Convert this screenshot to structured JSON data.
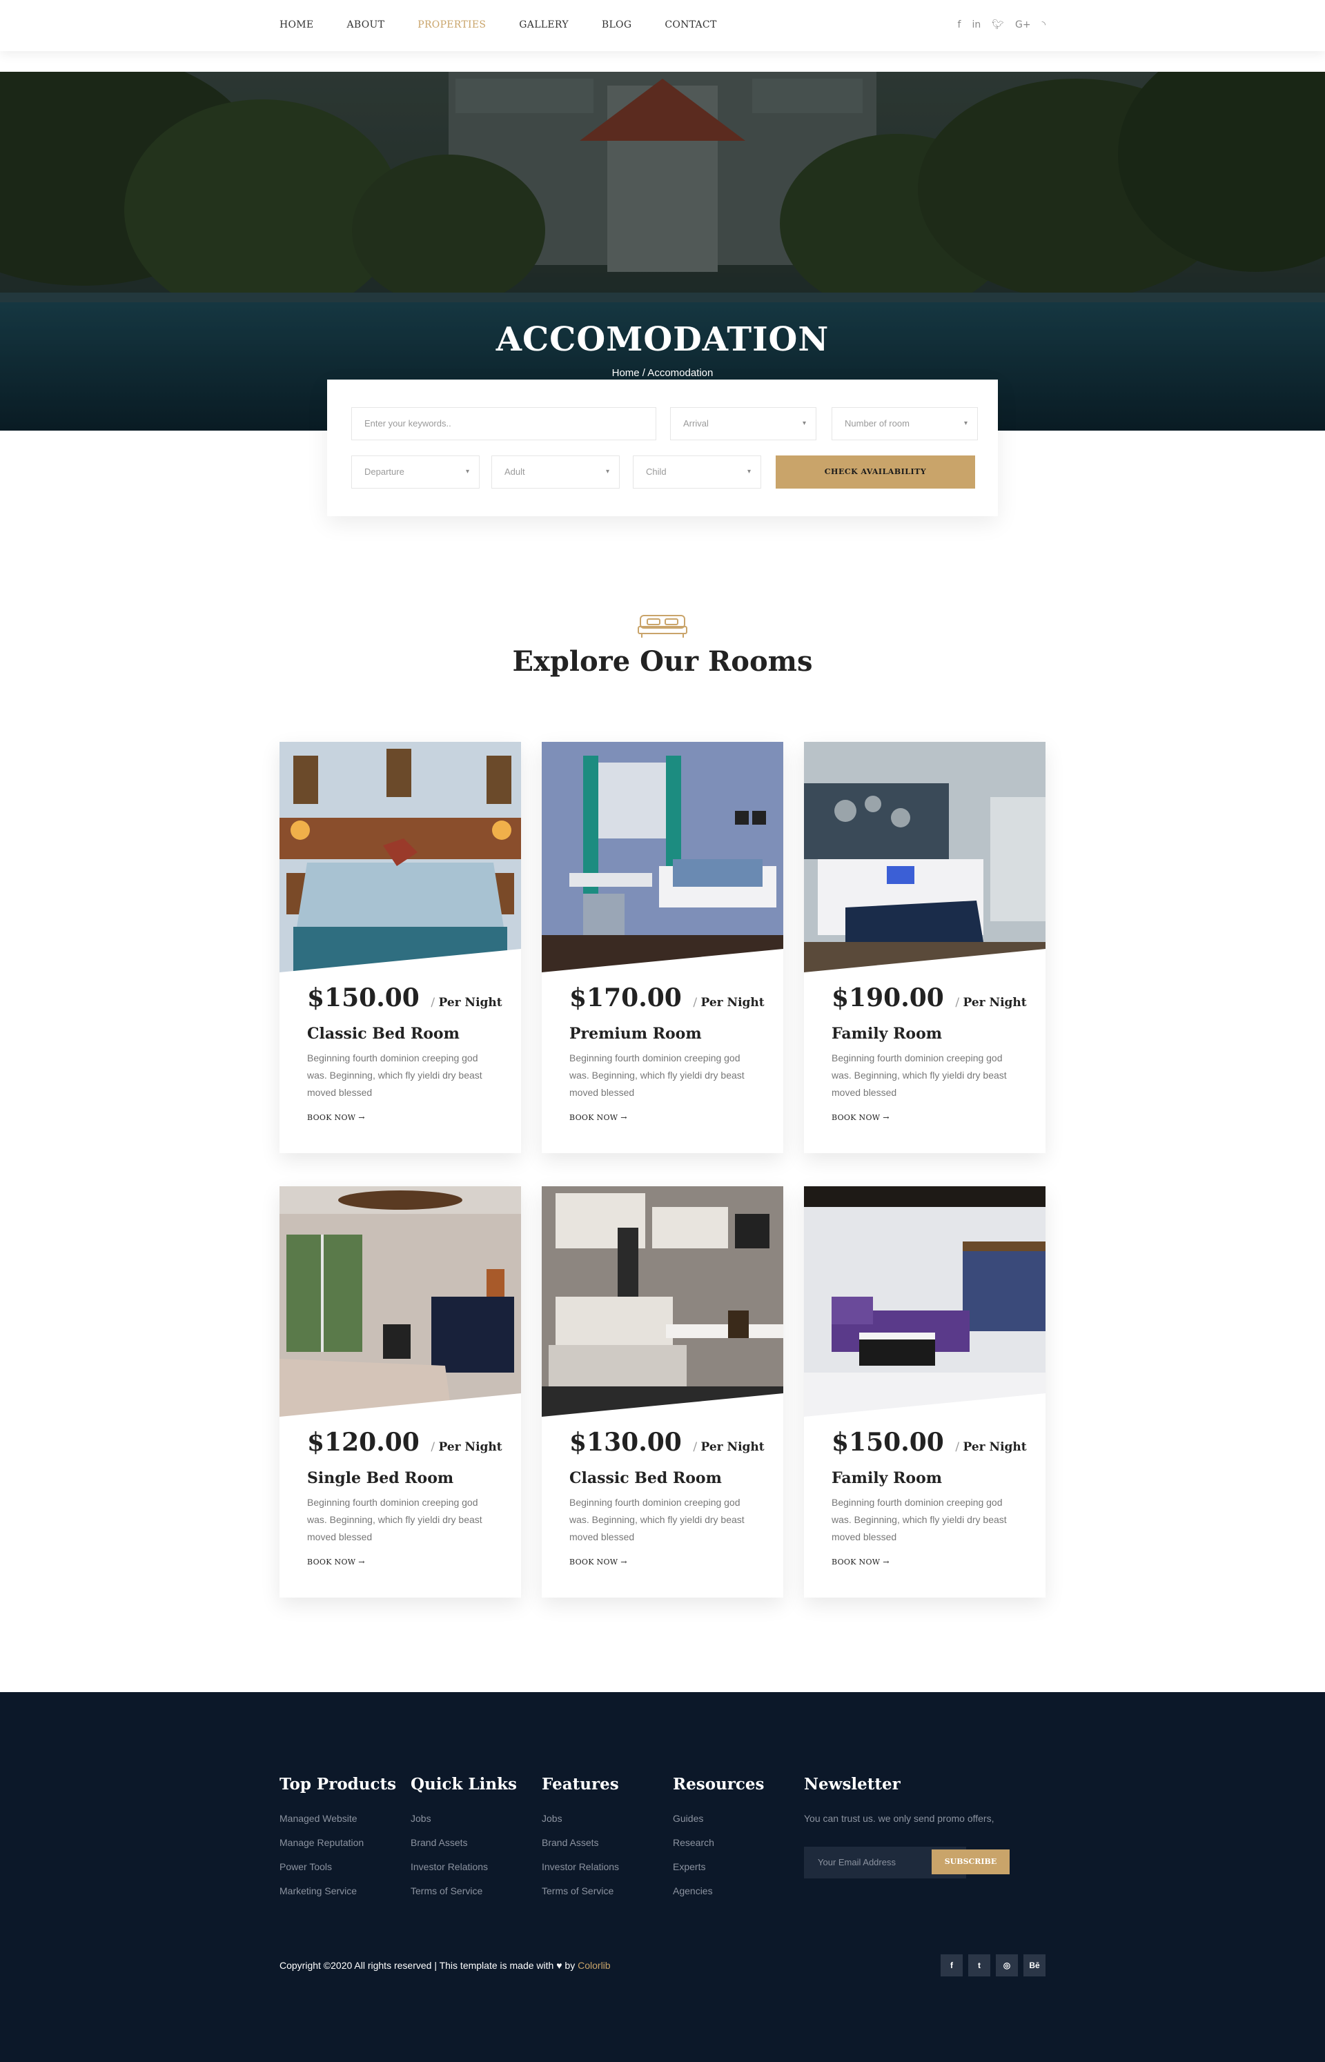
{
  "nav": {
    "items": [
      {
        "label": "HOME",
        "active": false
      },
      {
        "label": "ABOUT",
        "active": false
      },
      {
        "label": "PROPERTIES",
        "active": true
      },
      {
        "label": "GALLERY",
        "active": false
      },
      {
        "label": "BLOG",
        "active": false
      },
      {
        "label": "CONTACT",
        "active": false
      }
    ],
    "social_icons": [
      "facebook-icon",
      "linkedin-icon",
      "twitter-icon",
      "google-plus-icon",
      "rss-icon"
    ]
  },
  "hero": {
    "title": "ACCOMODATION",
    "breadcrumb": "Home / Accomodation"
  },
  "search": {
    "keywords_placeholder": "Enter your keywords..",
    "arrival": "Arrival",
    "rooms": "Number of room",
    "departure": "Departure",
    "adult": "Adult",
    "child": "Child",
    "button": "CHECK AVAILABILITY"
  },
  "rooms_section": {
    "title": "Explore Our Rooms",
    "per_night": "Per Night",
    "book_label": "BOOK NOW",
    "rooms": [
      {
        "price": "$150.00",
        "name": "Classic Bed Room",
        "desc": "Beginning fourth dominion creeping god was. Beginning, which fly yieldi dry beast moved blessed"
      },
      {
        "price": "$170.00",
        "name": "Premium Room",
        "desc": "Beginning fourth dominion creeping god was. Beginning, which fly yieldi dry beast moved blessed"
      },
      {
        "price": "$190.00",
        "name": "Family Room",
        "desc": "Beginning fourth dominion creeping god was. Beginning, which fly yieldi dry beast moved blessed"
      },
      {
        "price": "$120.00",
        "name": "Single Bed Room",
        "desc": "Beginning fourth dominion creeping god was. Beginning, which fly yieldi dry beast moved blessed"
      },
      {
        "price": "$130.00",
        "name": "Classic Bed Room",
        "desc": "Beginning fourth dominion creeping god was. Beginning, which fly yieldi dry beast moved blessed"
      },
      {
        "price": "$150.00",
        "name": "Family Room",
        "desc": "Beginning fourth dominion creeping god was. Beginning, which fly yieldi dry beast moved blessed"
      }
    ]
  },
  "footer": {
    "top_products": {
      "title": "Top Products",
      "items": [
        "Managed Website",
        "Manage Reputation",
        "Power Tools",
        "Marketing Service"
      ]
    },
    "quick_links": {
      "title": "Quick Links",
      "items": [
        "Jobs",
        "Brand Assets",
        "Investor Relations",
        "Terms of Service"
      ]
    },
    "features": {
      "title": "Features",
      "items": [
        "Jobs",
        "Brand Assets",
        "Investor Relations",
        "Terms of Service"
      ]
    },
    "resources": {
      "title": "Resources",
      "items": [
        "Guides",
        "Research",
        "Experts",
        "Agencies"
      ]
    },
    "newsletter": {
      "title": "Newsletter",
      "text": "You can trust us. we only send promo offers,",
      "email_placeholder": "Your Email Address",
      "button": "SUBSCRIBE"
    },
    "copyright_prefix": "Copyright ©2020 All rights reserved | This template is made with",
    "copyright_by": "by",
    "copyright_link": "Colorlib",
    "social_icons": [
      "facebook-icon",
      "twitter-icon",
      "dribbble-icon",
      "behance-icon"
    ]
  },
  "colors": {
    "accent": "#c9a46a",
    "footer_bg": "#0c1829"
  }
}
